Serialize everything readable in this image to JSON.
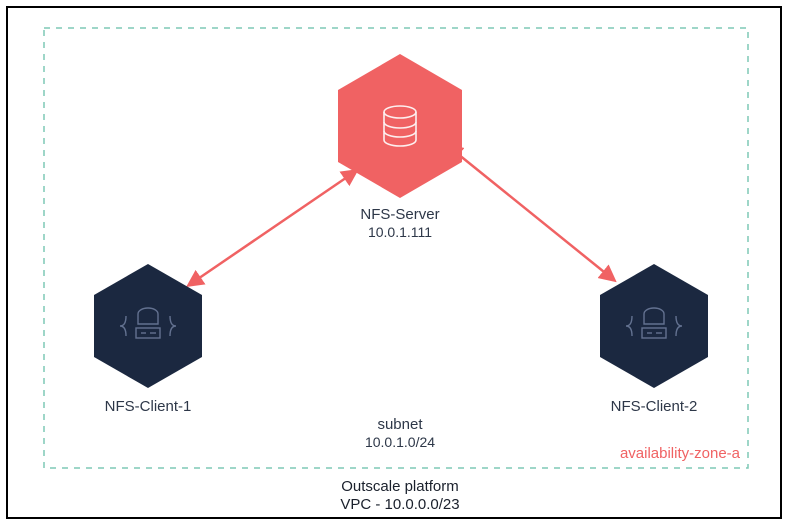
{
  "server": {
    "label": "NFS-Server",
    "ip": "10.0.1.111"
  },
  "client1": {
    "label": "NFS-Client-1"
  },
  "client2": {
    "label": "NFS-Client-2"
  },
  "subnet": {
    "label": "subnet",
    "cidr": "10.0.1.0/24"
  },
  "az": "availability-zone-a",
  "footer": {
    "line1": "Outscale platform",
    "line2": "VPC - 10.0.0.0/23"
  },
  "colors": {
    "accent": "#f06263",
    "node": "#1b2840",
    "dash": "#7fc9b6"
  }
}
